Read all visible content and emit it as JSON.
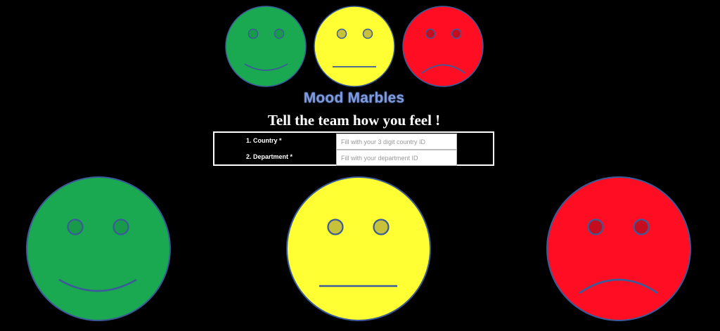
{
  "app": {
    "title": "Mood Marbles",
    "subtitle": "Tell the team how you feel !"
  },
  "form": {
    "fields": [
      {
        "label": "1. Country *",
        "placeholder": "Fill with your 3 digit country ID",
        "value": ""
      },
      {
        "label": "2. Department *",
        "placeholder": "Fill with your department ID",
        "value": ""
      }
    ]
  },
  "moods": [
    {
      "name": "happy",
      "color": "#1aa850"
    },
    {
      "name": "neutral",
      "color": "#ffff33"
    },
    {
      "name": "sad",
      "color": "#ff0d22"
    }
  ],
  "colors": {
    "background": "#000000",
    "title": "#7f9be0",
    "face_outline": "#3a5a9a",
    "happy_eye": "#199a4a",
    "neutral_eye": "#c8c23a",
    "sad_eye": "#c50c1e"
  }
}
